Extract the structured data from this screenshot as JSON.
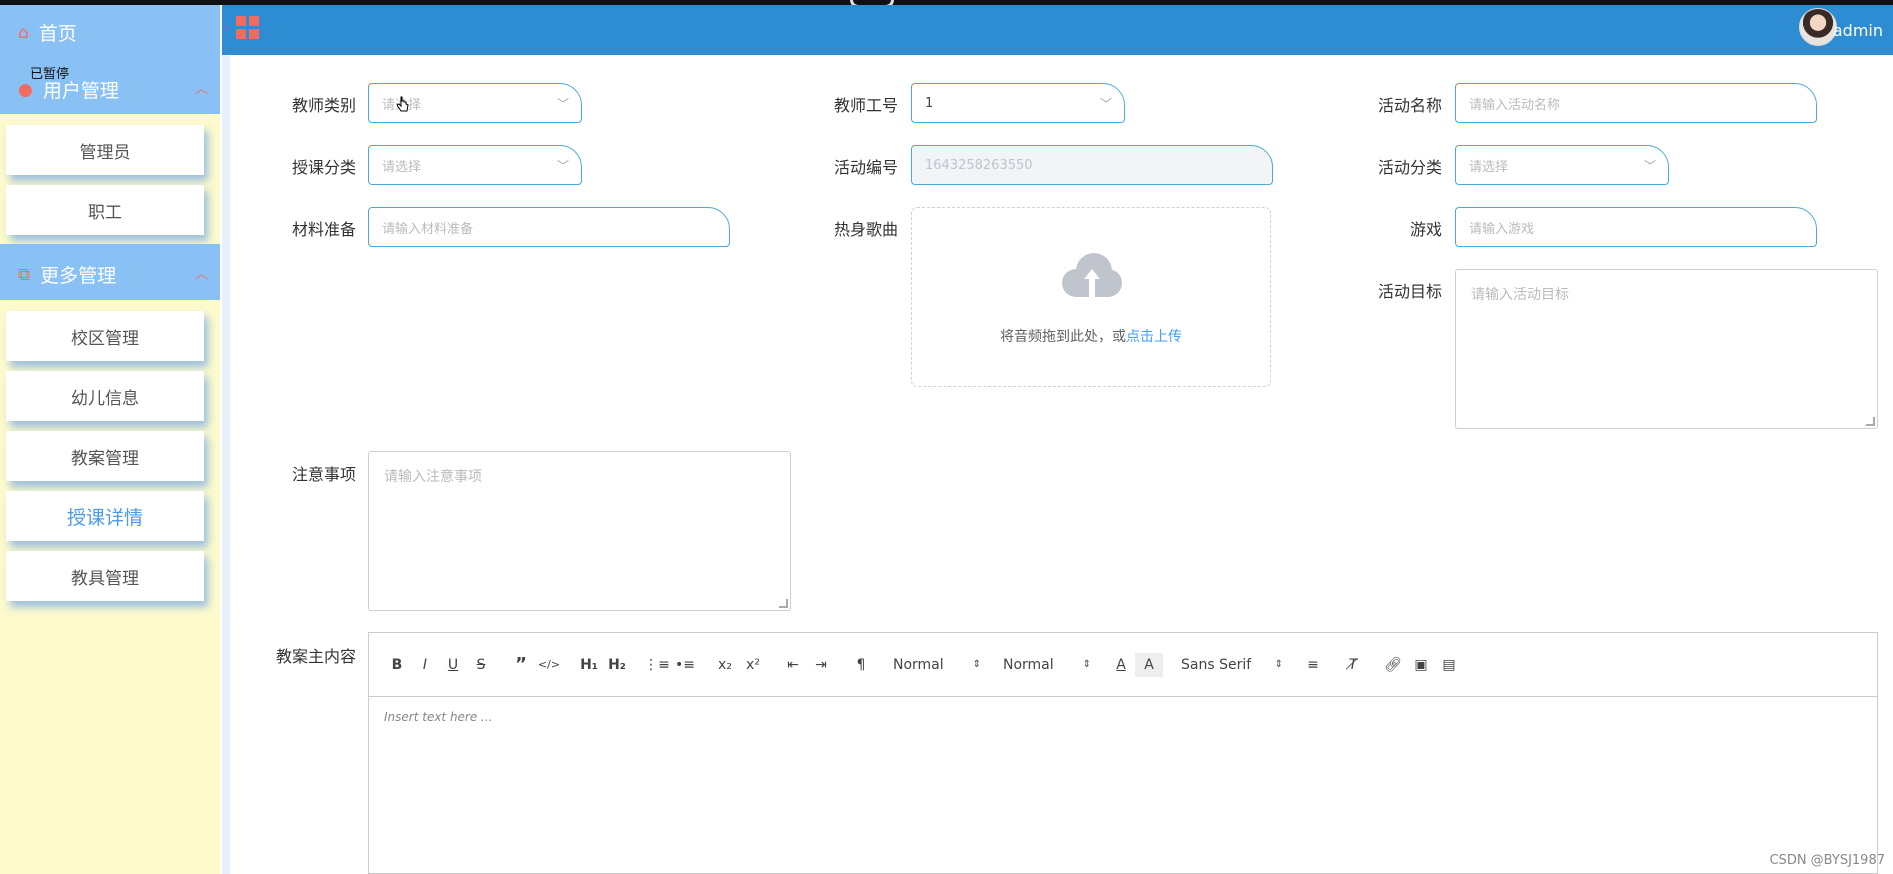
{
  "sidebar": {
    "home": "首页",
    "paused": "已暂停",
    "group1": {
      "title": "用户管理",
      "items": [
        "管理员",
        "职工"
      ]
    },
    "group2": {
      "title": "更多管理",
      "items": [
        "校区管理",
        "幼儿信息",
        "教案管理",
        "授课详情",
        "教具管理"
      ]
    },
    "active": "授课详情"
  },
  "header": {
    "username": "admin",
    "brand_color": "#2d8cd2",
    "accent": "#f26b5e"
  },
  "form": {
    "teacher_type": {
      "label": "教师类别",
      "placeholder": "请选择"
    },
    "teacher_no": {
      "label": "教师工号",
      "value": "1"
    },
    "activity_name": {
      "label": "活动名称",
      "placeholder": "请输入活动名称"
    },
    "course_category": {
      "label": "授课分类",
      "placeholder": "请选择"
    },
    "activity_no": {
      "label": "活动编号",
      "value": "1643258263550"
    },
    "activity_category": {
      "label": "活动分类",
      "placeholder": "请选择"
    },
    "materials": {
      "label": "材料准备",
      "placeholder": "请输入材料准备"
    },
    "warmup_song": {
      "label": "热身歌曲",
      "upload_text": "将音频拖到此处，或",
      "upload_link": "点击上传"
    },
    "game": {
      "label": "游戏",
      "placeholder": "请输入游戏"
    },
    "activity_goal": {
      "label": "活动目标",
      "placeholder": "请输入活动目标"
    },
    "notes": {
      "label": "注意事项",
      "placeholder": "请输入注意事项"
    },
    "main_content": {
      "label": "教案主内容",
      "placeholder": "Insert text here ..."
    }
  },
  "editor_toolbar": {
    "header_picker": "Normal",
    "size_picker": "Normal",
    "font_picker": "Sans Serif"
  },
  "watermark": "CSDN @BYSJ1987"
}
